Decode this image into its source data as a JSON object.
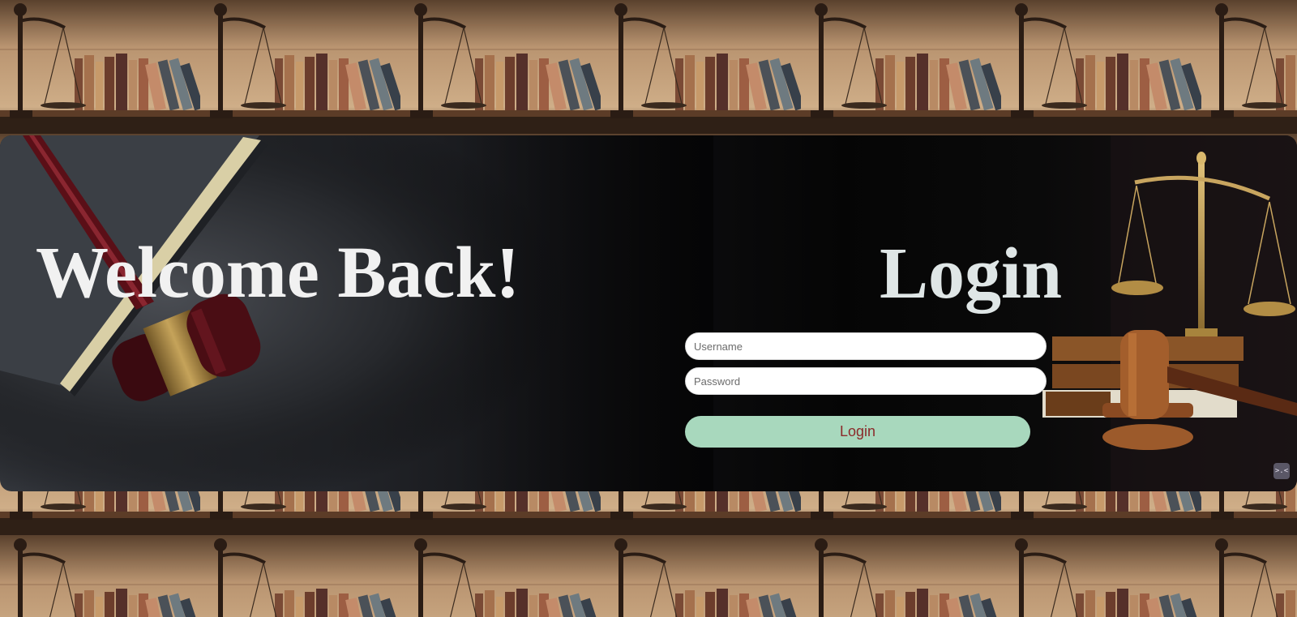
{
  "welcome": {
    "title": "Welcome Back!"
  },
  "login": {
    "title": "Login",
    "username": {
      "placeholder": "Username",
      "value": ""
    },
    "password": {
      "placeholder": "Password",
      "value": ""
    },
    "submit_label": "Login"
  },
  "widget": {
    "glyph": ">.<"
  },
  "colors": {
    "login_button_bg": "#a8d8bd",
    "login_button_text": "#8b2a2a",
    "title_text": "#f1f1f1"
  },
  "icons": {
    "background": "law-library-shelf-image",
    "left_art": "gavel-and-book-image",
    "right_art": "scales-of-justice-image"
  }
}
